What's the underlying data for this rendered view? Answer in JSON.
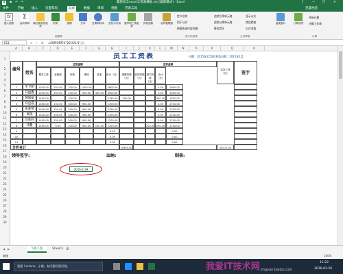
{
  "window": {
    "title": "最新员工excel工资表模板.xls  [兼容模式] - Excel",
    "user": "百度经验",
    "help": "?",
    "minimize": "—",
    "restore": "❐",
    "close": "✕"
  },
  "tabs": [
    "文件",
    "开始",
    "插入",
    "页面布局",
    "公式",
    "数据",
    "审阅",
    "视图",
    "开发工具"
  ],
  "active_tab": "公式",
  "ribbon": {
    "buttons": [
      {
        "label": "插入函数",
        "icon": "fx-icon"
      },
      {
        "label": "自动求和",
        "icon": "sum-icon"
      },
      {
        "label": "最近使用的函数",
        "icon": "star-icon"
      },
      {
        "label": "财务",
        "icon": "finance-icon"
      },
      {
        "label": "逻辑",
        "icon": "logic-icon"
      },
      {
        "label": "文本",
        "icon": "text-icon"
      },
      {
        "label": "日期和时间",
        "icon": "clock-icon"
      },
      {
        "label": "查找与引用",
        "icon": "lookup-icon"
      },
      {
        "label": "数学和三角函数",
        "icon": "math-icon"
      },
      {
        "label": "其他函数",
        "icon": "more-icon"
      },
      {
        "label": "名称管理器",
        "icon": "name-icon"
      }
    ],
    "name_items": [
      "定义名称",
      "用于公式",
      "根据所选内容创建"
    ],
    "audit_items": [
      "追踪引用单元格",
      "追踪从属单元格",
      "移去箭头",
      "显示公式",
      "错误检查",
      "公式求值"
    ],
    "watch_window": "监视窗口",
    "calc_options": "计算选项",
    "calc_now": "开始计算",
    "calc_sheet": "计算工作表",
    "group_labels": [
      "函数库",
      "定义的名称",
      "公式审核",
      "计算"
    ]
  },
  "formula_bar": {
    "name_box": "E21",
    "formula": "=EOMONTH(\"2016/1/1\",1)"
  },
  "columns": [
    "A",
    "B",
    "C",
    "D",
    "E",
    "F",
    "G",
    "H",
    "I",
    "J",
    "K",
    "L",
    "M",
    "N",
    "O",
    "P",
    "Q",
    "R"
  ],
  "rows": [
    "1",
    "2",
    "3",
    "4",
    "5",
    "6",
    "7",
    "8",
    "9",
    "10",
    "11",
    "12",
    "13",
    "14",
    "15",
    "16",
    "17",
    "18",
    "19",
    "20",
    "21",
    "22",
    "23",
    "24",
    "25",
    "26",
    "27",
    "28",
    "29",
    "30"
  ],
  "sheet": {
    "title": "员工工资表",
    "date_line": "日期：2015年2月28  财务日期：2015年1月",
    "headers": {
      "no": "编号",
      "name": "姓名",
      "payable": "应发金额",
      "deduction": "应扣金额",
      "actual": "实发工资（元）",
      "sign": "签字",
      "sub": [
        "基本工资",
        "全勤奖",
        "补助",
        "绩效",
        "奖金",
        "合计（元）",
        "请假扣款（元）",
        "迟到扣款（元）",
        "其它扣款（元）",
        "合计（元）"
      ]
    },
    "rows": [
      {
        "no": "1",
        "name": "王卫明",
        "vals": [
          "1450.00",
          "150.00",
          "200.00",
          "1000.00",
          "",
          "2800.00",
          "",
          "",
          "",
          "0.00",
          "2800.00"
        ]
      },
      {
        "no": "2",
        "name": "马国鑫",
        "vals": [
          "1450.00",
          "150.00",
          "200.00",
          "900.00",
          "300.00",
          "3000.00",
          "",
          "",
          "",
          "0.00",
          "3000.00"
        ]
      },
      {
        "no": "3",
        "name": "郝国斌",
        "vals": [
          "1450.00",
          "",
          "700.00",
          "",
          "",
          "2150.00",
          "330.00",
          "",
          "",
          "330.00",
          "1820.00"
        ]
      },
      {
        "no": "4",
        "name": "马启成",
        "vals": [
          "1450.00",
          "150.00",
          "200.00",
          "900.00",
          "",
          "2700.00",
          "",
          "",
          "",
          "0.00",
          "2700.00"
        ]
      },
      {
        "no": "5",
        "name": "张爱琴",
        "vals": [
          "1450.00",
          "150.00",
          "200.00",
          "900.00",
          "",
          "2700.00",
          "",
          "",
          "",
          "0.00",
          "2700.00"
        ]
      },
      {
        "no": "6",
        "name": "高阳",
        "vals": [
          "1450.00",
          "150.00",
          "200.00",
          "300.00",
          "",
          "2100.00",
          "",
          "",
          "",
          "0.00",
          "2100.00"
        ]
      },
      {
        "no": "7",
        "name": "马会莉",
        "vals": [
          "1450.00",
          "150.00",
          "200.00",
          "900.00",
          "",
          "2700.00",
          "",
          "",
          "",
          "0.00",
          "2700.00"
        ]
      },
      {
        "no": "8",
        "name": "邓鑫",
        "vals": [
          "1450.00",
          "0.00",
          "200.00",
          "500.00",
          "150.00",
          "2300.00",
          "",
          "",
          "200.00",
          "200.00",
          "2100.00"
        ]
      },
      {
        "no": "9",
        "name": "",
        "vals": [
          "",
          "",
          "",
          "",
          "",
          "0.00",
          "",
          "",
          "",
          "",
          "0.00"
        ]
      },
      {
        "no": "10",
        "name": "",
        "vals": [
          "",
          "",
          "",
          "",
          "",
          "0.00",
          "",
          "",
          "",
          "",
          "0.00"
        ]
      },
      {
        "no": "11",
        "name": "",
        "vals": [
          "",
          "",
          "",
          "",
          "",
          "0.00",
          "",
          "",
          "",
          "",
          "0.00"
        ]
      }
    ],
    "total_label": "分栏合计",
    "total_sum": "19300.00",
    "total_actual": "18770.00",
    "sign_labels": [
      "领导签字:",
      "出纳:",
      "制表:"
    ],
    "active_cell_value": "2016-2-29"
  },
  "sheet_tabs": [
    "5月工资",
    "Sheet3"
  ],
  "status": {
    "ready": "就绪",
    "zoom": "100%"
  },
  "taskbar": {
    "search": "我是 Cortana，小娜。有问题尽管问我。",
    "time": "11:22",
    "date": "2016-02-26",
    "watermark": "我爱IT技术网",
    "site": "jingyan.baidu.com"
  },
  "colors": {
    "excel_green": "#217346",
    "title_blue": "#1a3e8a",
    "highlight_red": "#cc1010"
  }
}
